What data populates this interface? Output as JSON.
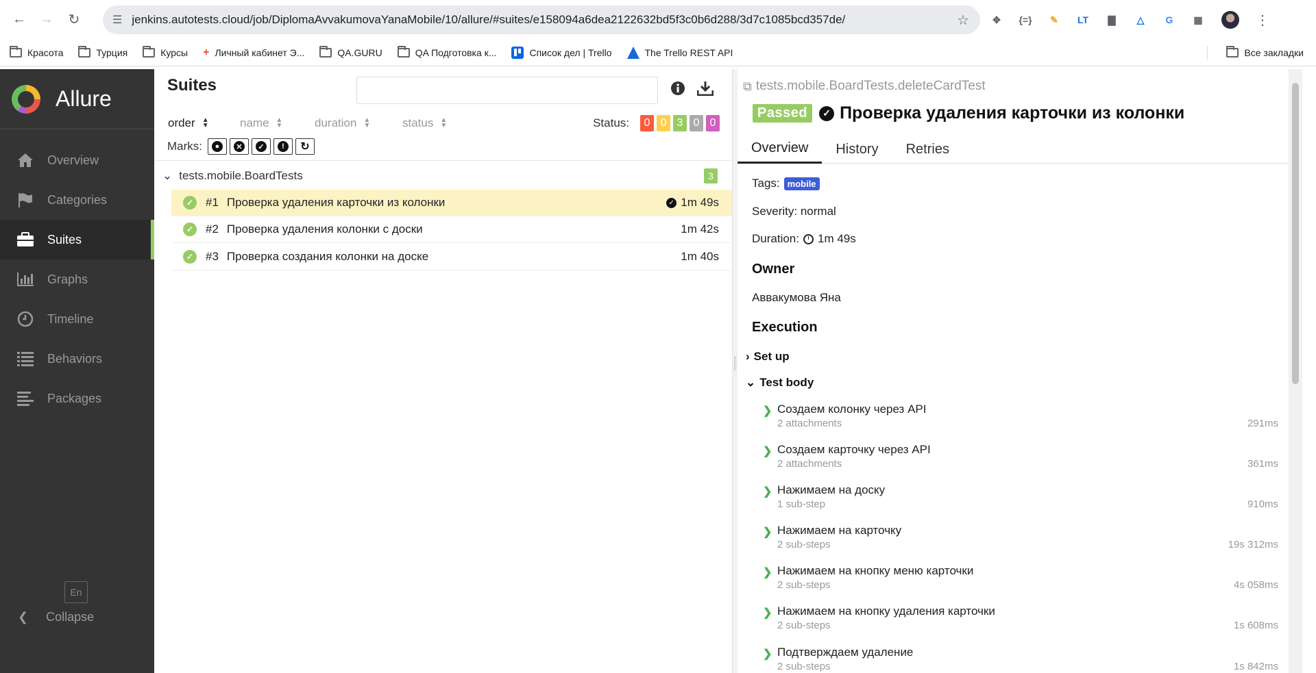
{
  "browser": {
    "url": "jenkins.autotests.cloud/job/DiplomaAvvakumovaYanaMobile/10/allure/#suites/e158094a6dea2122632bd5f3c0b6d288/3d7c1085bcd357de/"
  },
  "bookmarks": [
    {
      "label": "Красота",
      "icon": "folder-icon"
    },
    {
      "label": "Турция",
      "icon": "folder-icon"
    },
    {
      "label": "Курсы",
      "icon": "folder-icon"
    },
    {
      "label": "Личный кабинет Э...",
      "icon": "plus-icon"
    },
    {
      "label": "QA.GURU",
      "icon": "folder-icon"
    },
    {
      "label": "QA Подготовка к...",
      "icon": "folder-icon"
    },
    {
      "label": "Список дел | Trello",
      "icon": "trello-icon"
    },
    {
      "label": "The Trello REST API",
      "icon": "atlassian-icon"
    }
  ],
  "all_bookmarks": "Все закладки",
  "sidebar": {
    "logo": "Allure",
    "items": [
      {
        "label": "Overview",
        "icon": "home-icon"
      },
      {
        "label": "Categories",
        "icon": "flag-icon"
      },
      {
        "label": "Suites",
        "icon": "briefcase-icon"
      },
      {
        "label": "Graphs",
        "icon": "bar-chart-icon"
      },
      {
        "label": "Timeline",
        "icon": "clock-icon"
      },
      {
        "label": "Behaviors",
        "icon": "list-icon"
      },
      {
        "label": "Packages",
        "icon": "align-left-icon"
      }
    ],
    "active": "Suites",
    "lang": "En",
    "collapse": "Collapse"
  },
  "suites": {
    "title": "Suites",
    "sort": [
      "order",
      "name",
      "duration",
      "status"
    ],
    "status_label": "Status:",
    "status_counts": [
      {
        "value": "0",
        "color": "#fd5a3e"
      },
      {
        "value": "0",
        "color": "#ffd050"
      },
      {
        "value": "3",
        "color": "#97cc64"
      },
      {
        "value": "0",
        "color": "#aaaaaa"
      },
      {
        "value": "0",
        "color": "#d35ebe"
      }
    ],
    "marks_label": "Marks:",
    "group": {
      "name": "tests.mobile.BoardTests",
      "count": "3"
    },
    "tests": [
      {
        "num": "#1",
        "name": "Проверка удаления карточки из колонки",
        "duration": "1m 49s",
        "selected": true
      },
      {
        "num": "#2",
        "name": "Проверка удаления колонки с доски",
        "duration": "1m 42s",
        "selected": false
      },
      {
        "num": "#3",
        "name": "Проверка создания колонки на доске",
        "duration": "1m 40s",
        "selected": false
      }
    ]
  },
  "detail": {
    "path": "tests.mobile.BoardTests.deleteCardTest",
    "status": "Passed",
    "title": "Проверка удаления карточки из колонки",
    "tabs": [
      "Overview",
      "History",
      "Retries"
    ],
    "tags_label": "Tags:",
    "tag": "mobile",
    "severity": "Severity: normal",
    "duration_label": "Duration:",
    "duration": "1m 49s",
    "owner_heading": "Owner",
    "owner": "Аввакумова Яна",
    "execution_heading": "Execution",
    "setup": "Set up",
    "test_body": "Test body",
    "steps": [
      {
        "name": "Создаем колонку через API",
        "sub": "2 attachments",
        "time": "291ms"
      },
      {
        "name": "Создаем карточку через API",
        "sub": "2 attachments",
        "time": "361ms"
      },
      {
        "name": "Нажимаем на доску",
        "sub": "1 sub-step",
        "time": "910ms"
      },
      {
        "name": "Нажимаем на карточку",
        "sub": "2 sub-steps",
        "time": "19s 312ms"
      },
      {
        "name": "Нажимаем на кнопку меню карточки",
        "sub": "2 sub-steps",
        "time": "4s 058ms"
      },
      {
        "name": "Нажимаем на кнопку удаления карточки",
        "sub": "2 sub-steps",
        "time": "1s 608ms"
      },
      {
        "name": "Подтверждаем удаление",
        "sub": "2 sub-steps",
        "time": "1s 842ms"
      }
    ]
  }
}
